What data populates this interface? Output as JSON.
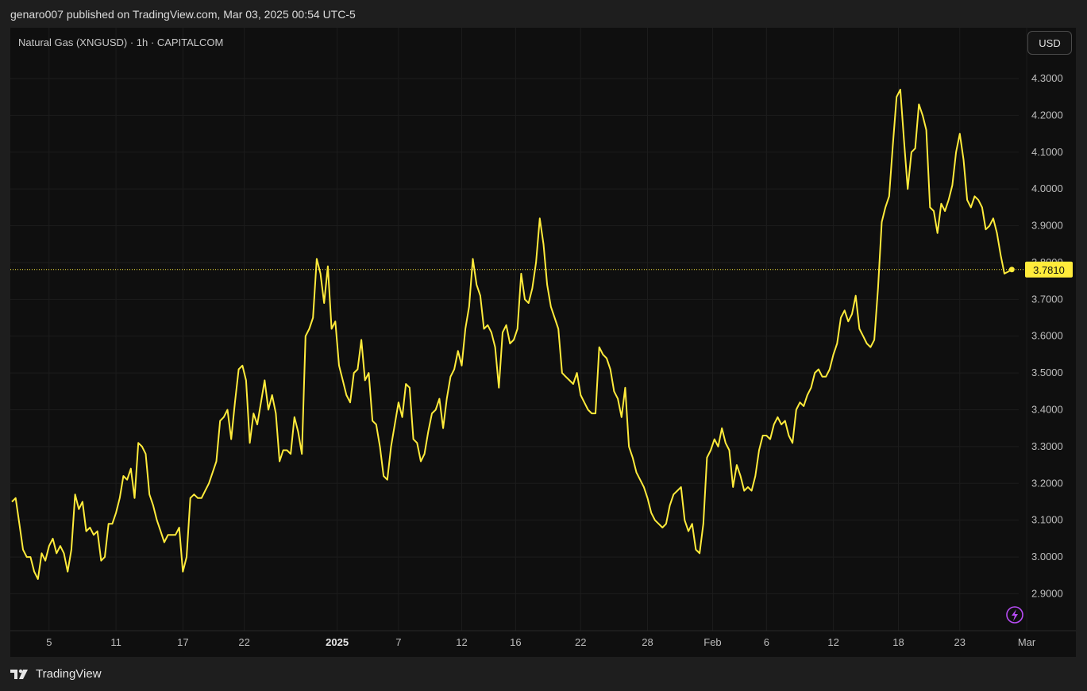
{
  "header": {
    "text": "genaro007 published on TradingView.com, Mar 03, 2025 00:54 UTC-5"
  },
  "symbol": {
    "label": "Natural Gas (XNGUSD) · 1h · CAPITALCOM"
  },
  "currency_button": {
    "label": "USD"
  },
  "footer": {
    "brand": "TradingView"
  },
  "colors": {
    "line": "#ffeb3b",
    "background": "#0f0f0f",
    "frame": "#1e1e1e",
    "grid": "#1c1c1c",
    "accent_icon": "#b84cf5"
  },
  "icons": {
    "logo": "tradingview-logo-icon",
    "lightning": "lightning-icon"
  },
  "chart_data": {
    "type": "line",
    "series": [
      {
        "points": [
          [
            0,
            3.15
          ],
          [
            2,
            3.16
          ],
          [
            4,
            3.09
          ],
          [
            6,
            3.02
          ],
          [
            8,
            3.0
          ],
          [
            10,
            3.0
          ],
          [
            12,
            2.96
          ],
          [
            14,
            2.94
          ],
          [
            16,
            3.01
          ],
          [
            18,
            2.99
          ],
          [
            20,
            3.03
          ],
          [
            22,
            3.05
          ],
          [
            24,
            3.01
          ],
          [
            26,
            3.03
          ],
          [
            28,
            3.01
          ],
          [
            30,
            2.96
          ],
          [
            32,
            3.02
          ],
          [
            34,
            3.17
          ],
          [
            36,
            3.13
          ],
          [
            38,
            3.15
          ],
          [
            40,
            3.07
          ],
          [
            42,
            3.08
          ],
          [
            44,
            3.06
          ],
          [
            46,
            3.07
          ],
          [
            48,
            2.99
          ],
          [
            50,
            3.0
          ],
          [
            52,
            3.09
          ],
          [
            54,
            3.09
          ],
          [
            56,
            3.12
          ],
          [
            58,
            3.16
          ],
          [
            60,
            3.22
          ],
          [
            62,
            3.21
          ],
          [
            64,
            3.24
          ],
          [
            66,
            3.16
          ],
          [
            68,
            3.31
          ],
          [
            70,
            3.3
          ],
          [
            72,
            3.28
          ],
          [
            74,
            3.17
          ],
          [
            76,
            3.14
          ],
          [
            78,
            3.1
          ],
          [
            80,
            3.07
          ],
          [
            82,
            3.04
          ],
          [
            84,
            3.06
          ],
          [
            86,
            3.06
          ],
          [
            88,
            3.06
          ],
          [
            90,
            3.08
          ],
          [
            92,
            2.96
          ],
          [
            94,
            3.0
          ],
          [
            96,
            3.16
          ],
          [
            98,
            3.17
          ],
          [
            100,
            3.16
          ],
          [
            102,
            3.16
          ],
          [
            104,
            3.18
          ],
          [
            106,
            3.2
          ],
          [
            108,
            3.23
          ],
          [
            110,
            3.26
          ],
          [
            112,
            3.37
          ],
          [
            114,
            3.38
          ],
          [
            116,
            3.4
          ],
          [
            118,
            3.32
          ],
          [
            120,
            3.42
          ],
          [
            122,
            3.51
          ],
          [
            124,
            3.52
          ],
          [
            126,
            3.48
          ],
          [
            128,
            3.31
          ],
          [
            130,
            3.39
          ],
          [
            132,
            3.36
          ],
          [
            134,
            3.42
          ],
          [
            136,
            3.48
          ],
          [
            138,
            3.4
          ],
          [
            140,
            3.44
          ],
          [
            142,
            3.39
          ],
          [
            144,
            3.26
          ],
          [
            146,
            3.29
          ],
          [
            148,
            3.29
          ],
          [
            150,
            3.28
          ],
          [
            152,
            3.38
          ],
          [
            154,
            3.34
          ],
          [
            156,
            3.28
          ],
          [
            158,
            3.6
          ],
          [
            160,
            3.62
          ],
          [
            162,
            3.65
          ],
          [
            164,
            3.81
          ],
          [
            166,
            3.77
          ],
          [
            168,
            3.69
          ],
          [
            170,
            3.79
          ],
          [
            172,
            3.62
          ],
          [
            174,
            3.64
          ],
          [
            176,
            3.52
          ],
          [
            178,
            3.48
          ],
          [
            180,
            3.44
          ],
          [
            182,
            3.42
          ],
          [
            184,
            3.5
          ],
          [
            186,
            3.51
          ],
          [
            188,
            3.59
          ],
          [
            190,
            3.48
          ],
          [
            192,
            3.5
          ],
          [
            194,
            3.37
          ],
          [
            196,
            3.36
          ],
          [
            198,
            3.3
          ],
          [
            200,
            3.22
          ],
          [
            202,
            3.21
          ],
          [
            204,
            3.3
          ],
          [
            206,
            3.36
          ],
          [
            208,
            3.42
          ],
          [
            210,
            3.38
          ],
          [
            212,
            3.47
          ],
          [
            214,
            3.46
          ],
          [
            216,
            3.32
          ],
          [
            218,
            3.31
          ],
          [
            220,
            3.26
          ],
          [
            222,
            3.28
          ],
          [
            224,
            3.34
          ],
          [
            226,
            3.39
          ],
          [
            228,
            3.4
          ],
          [
            230,
            3.43
          ],
          [
            232,
            3.35
          ],
          [
            234,
            3.43
          ],
          [
            236,
            3.49
          ],
          [
            238,
            3.51
          ],
          [
            240,
            3.56
          ],
          [
            242,
            3.52
          ],
          [
            244,
            3.62
          ],
          [
            246,
            3.68
          ],
          [
            248,
            3.81
          ],
          [
            250,
            3.74
          ],
          [
            252,
            3.71
          ],
          [
            254,
            3.62
          ],
          [
            256,
            3.63
          ],
          [
            258,
            3.61
          ],
          [
            260,
            3.57
          ],
          [
            262,
            3.46
          ],
          [
            264,
            3.61
          ],
          [
            266,
            3.63
          ],
          [
            268,
            3.58
          ],
          [
            270,
            3.59
          ],
          [
            272,
            3.62
          ],
          [
            274,
            3.77
          ],
          [
            276,
            3.7
          ],
          [
            278,
            3.69
          ],
          [
            280,
            3.73
          ],
          [
            282,
            3.8
          ],
          [
            284,
            3.92
          ],
          [
            286,
            3.85
          ],
          [
            288,
            3.74
          ],
          [
            290,
            3.68
          ],
          [
            292,
            3.65
          ],
          [
            294,
            3.62
          ],
          [
            296,
            3.5
          ],
          [
            298,
            3.49
          ],
          [
            300,
            3.48
          ],
          [
            302,
            3.47
          ],
          [
            304,
            3.5
          ],
          [
            306,
            3.44
          ],
          [
            308,
            3.42
          ],
          [
            310,
            3.4
          ],
          [
            312,
            3.39
          ],
          [
            314,
            3.39
          ],
          [
            316,
            3.57
          ],
          [
            318,
            3.55
          ],
          [
            320,
            3.54
          ],
          [
            322,
            3.51
          ],
          [
            324,
            3.45
          ],
          [
            326,
            3.43
          ],
          [
            328,
            3.38
          ],
          [
            330,
            3.46
          ],
          [
            332,
            3.3
          ],
          [
            334,
            3.27
          ],
          [
            336,
            3.23
          ],
          [
            338,
            3.21
          ],
          [
            340,
            3.19
          ],
          [
            342,
            3.16
          ],
          [
            344,
            3.12
          ],
          [
            346,
            3.1
          ],
          [
            348,
            3.09
          ],
          [
            350,
            3.08
          ],
          [
            352,
            3.09
          ],
          [
            354,
            3.14
          ],
          [
            356,
            3.17
          ],
          [
            358,
            3.18
          ],
          [
            360,
            3.19
          ],
          [
            362,
            3.1
          ],
          [
            364,
            3.07
          ],
          [
            366,
            3.09
          ],
          [
            368,
            3.02
          ],
          [
            370,
            3.01
          ],
          [
            372,
            3.09
          ],
          [
            374,
            3.27
          ],
          [
            376,
            3.29
          ],
          [
            378,
            3.32
          ],
          [
            380,
            3.3
          ],
          [
            382,
            3.35
          ],
          [
            384,
            3.31
          ],
          [
            386,
            3.29
          ],
          [
            388,
            3.19
          ],
          [
            390,
            3.25
          ],
          [
            392,
            3.22
          ],
          [
            394,
            3.18
          ],
          [
            396,
            3.19
          ],
          [
            398,
            3.18
          ],
          [
            400,
            3.22
          ],
          [
            402,
            3.29
          ],
          [
            404,
            3.33
          ],
          [
            406,
            3.33
          ],
          [
            408,
            3.32
          ],
          [
            410,
            3.36
          ],
          [
            412,
            3.38
          ],
          [
            414,
            3.36
          ],
          [
            416,
            3.37
          ],
          [
            418,
            3.33
          ],
          [
            420,
            3.31
          ],
          [
            422,
            3.4
          ],
          [
            424,
            3.42
          ],
          [
            426,
            3.41
          ],
          [
            428,
            3.44
          ],
          [
            430,
            3.46
          ],
          [
            432,
            3.5
          ],
          [
            434,
            3.51
          ],
          [
            436,
            3.49
          ],
          [
            438,
            3.49
          ],
          [
            440,
            3.51
          ],
          [
            442,
            3.55
          ],
          [
            444,
            3.58
          ],
          [
            446,
            3.65
          ],
          [
            448,
            3.67
          ],
          [
            450,
            3.64
          ],
          [
            452,
            3.66
          ],
          [
            454,
            3.71
          ],
          [
            456,
            3.62
          ],
          [
            458,
            3.6
          ],
          [
            460,
            3.58
          ],
          [
            462,
            3.57
          ],
          [
            464,
            3.59
          ],
          [
            466,
            3.73
          ],
          [
            468,
            3.91
          ],
          [
            470,
            3.95
          ],
          [
            472,
            3.98
          ],
          [
            474,
            4.12
          ],
          [
            476,
            4.25
          ],
          [
            478,
            4.27
          ],
          [
            480,
            4.13
          ],
          [
            482,
            4.0
          ],
          [
            484,
            4.1
          ],
          [
            486,
            4.11
          ],
          [
            488,
            4.23
          ],
          [
            490,
            4.2
          ],
          [
            492,
            4.16
          ],
          [
            494,
            3.95
          ],
          [
            496,
            3.94
          ],
          [
            498,
            3.88
          ],
          [
            500,
            3.96
          ],
          [
            502,
            3.94
          ],
          [
            504,
            3.97
          ],
          [
            506,
            4.01
          ],
          [
            508,
            4.1
          ],
          [
            510,
            4.15
          ],
          [
            512,
            4.08
          ],
          [
            514,
            3.97
          ],
          [
            516,
            3.95
          ],
          [
            518,
            3.98
          ],
          [
            520,
            3.97
          ],
          [
            522,
            3.95
          ],
          [
            524,
            3.89
          ],
          [
            526,
            3.9
          ],
          [
            528,
            3.92
          ],
          [
            530,
            3.88
          ],
          [
            532,
            3.82
          ],
          [
            534,
            3.77
          ],
          [
            536,
            3.775
          ],
          [
            538,
            3.781
          ]
        ]
      }
    ],
    "x_ticks": [
      {
        "t": 20,
        "label": "5"
      },
      {
        "t": 56,
        "label": "11"
      },
      {
        "t": 92,
        "label": "17"
      },
      {
        "t": 125,
        "label": "22"
      },
      {
        "t": 175,
        "label": "2025",
        "bold": true
      },
      {
        "t": 208,
        "label": "7"
      },
      {
        "t": 242,
        "label": "12"
      },
      {
        "t": 271,
        "label": "16"
      },
      {
        "t": 306,
        "label": "22"
      },
      {
        "t": 342,
        "label": "28"
      },
      {
        "t": 377,
        "label": "Feb"
      },
      {
        "t": 406,
        "label": "6"
      },
      {
        "t": 442,
        "label": "12"
      },
      {
        "t": 477,
        "label": "18"
      },
      {
        "t": 510,
        "label": "23"
      },
      {
        "t": 546,
        "label": "Mar"
      }
    ],
    "y_ticks": [
      "2.9000",
      "3.0000",
      "3.1000",
      "3.2000",
      "3.3000",
      "3.4000",
      "3.5000",
      "3.6000",
      "3.7000",
      "3.8000",
      "3.9000",
      "4.0000",
      "4.1000",
      "4.2000",
      "4.3000"
    ],
    "ylim": [
      2.8,
      4.35
    ],
    "xlim": [
      0,
      555
    ],
    "last_price": "3.7810",
    "last_value": 3.781,
    "grid": true
  }
}
